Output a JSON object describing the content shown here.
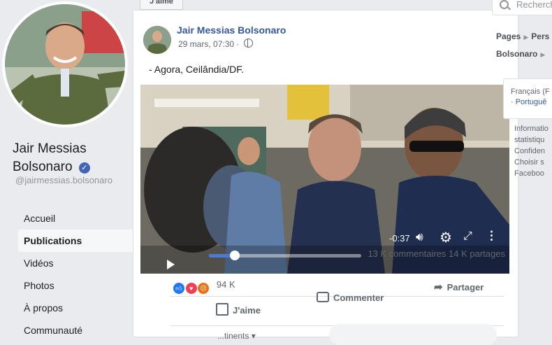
{
  "profile": {
    "name_line1": "Jair Messias",
    "name_line2": "Bolsonaro",
    "handle": "@jairmessias.bolsonaro",
    "verified_glyph": "✓",
    "verified_color": "#4267b2"
  },
  "nav": {
    "items": [
      {
        "label": "Accueil",
        "active": false
      },
      {
        "label": "Publications",
        "active": true
      },
      {
        "label": "Vidéos",
        "active": false
      },
      {
        "label": "Photos",
        "active": false
      },
      {
        "label": "À propos",
        "active": false
      },
      {
        "label": "Communauté",
        "active": false
      }
    ]
  },
  "header": {
    "like_button": "J'aime"
  },
  "post": {
    "author": "Jair Messias Bolsonaro",
    "date": "29 mars, 07:30 ·",
    "text": "- Agora, Ceilândia/DF.",
    "video": {
      "time_left": "-0:37",
      "progress": 0.17,
      "icons": [
        "play-icon",
        "volume-icon",
        "gear-icon",
        "expand-icon",
        "more-icon"
      ]
    },
    "counts": "13 K commentaires   14 K partages",
    "reactions": {
      "count": "94 K",
      "types": [
        "like",
        "love",
        "angry"
      ]
    },
    "actions": {
      "like": "J'aime",
      "comment": "Commenter",
      "share": "Partager"
    },
    "comments_filter": "...tinents ▾"
  },
  "right": {
    "search_placeholder": "Rechercher",
    "crumbs": [
      "Pages",
      "Pers",
      "Bolsonaro"
    ],
    "lang_current": "Français (F",
    "lang_other": "· Portuguê",
    "footer_lines": [
      "Informatio",
      "statistiqu",
      "Confiden",
      "Choisir s",
      "Faceboo"
    ]
  },
  "colors": {
    "accent": "#365899",
    "progress": "#4a7bd8",
    "page_bg": "#e9ebee"
  }
}
